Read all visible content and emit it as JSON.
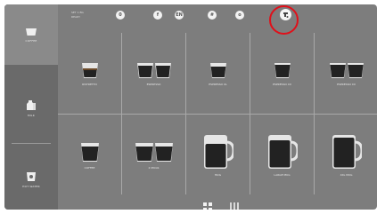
{
  "sidebar": {
    "items": [
      {
        "label": "COFFEE",
        "icon": "cup-icon",
        "active": true
      },
      {
        "label": "MILK",
        "icon": "milk-icon",
        "active": false
      },
      {
        "label": "HOT WATER",
        "icon": "hot-water-icon",
        "active": false
      }
    ]
  },
  "topbar": {
    "line1": "SET 1 BG",
    "line2": "READY",
    "buttons": [
      {
        "label": "0",
        "icon": "zero-icon"
      },
      {
        "label": "f",
        "icon": "info-icon"
      },
      {
        "label": "EN",
        "icon": "language-icon"
      },
      {
        "label": "#",
        "icon": "settings-icon"
      },
      {
        "label": "o",
        "icon": "power-icon"
      },
      {
        "label": "",
        "icon": "maintenance-icon"
      }
    ]
  },
  "beverages": [
    {
      "label": "RISTRETTO",
      "glass": "small-cup",
      "count": 1
    },
    {
      "label": "ESPRESSO",
      "glass": "small-cup",
      "count": 2
    },
    {
      "label": "ESPRESSO XL",
      "glass": "small-cup",
      "count": 1
    },
    {
      "label": "ESPRESSO XX",
      "glass": "small-cup",
      "count": 1
    },
    {
      "label": "ESPRESSO XX",
      "glass": "small-cup",
      "count": 2
    },
    {
      "label": "COFFEE",
      "glass": "cup",
      "count": 1
    },
    {
      "label": "2 MUGS",
      "glass": "cup",
      "count": 2
    },
    {
      "label": "MUG",
      "glass": "mug",
      "count": 1
    },
    {
      "label": "LARGE MUG",
      "glass": "mug",
      "count": 1
    },
    {
      "label": "XXL MUG",
      "glass": "mug",
      "count": 1
    }
  ],
  "colors": {
    "highlight": "#e0101a",
    "background": "#7d7d7d",
    "sidebar": "#6a6a6a"
  }
}
